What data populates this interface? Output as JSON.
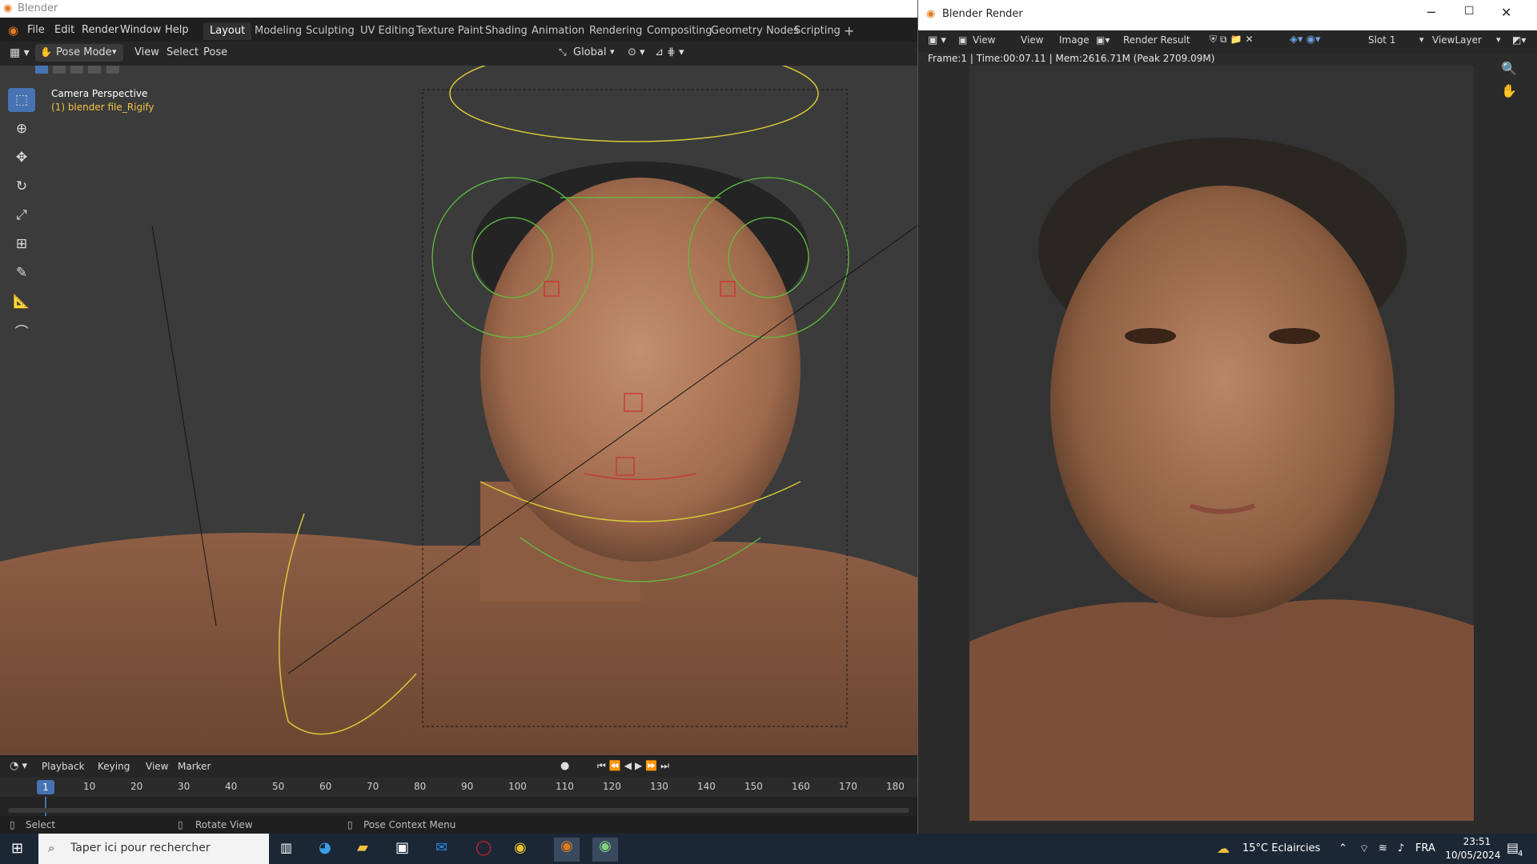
{
  "main_window": {
    "title": "Blender",
    "menu": [
      "File",
      "Edit",
      "Render",
      "Window",
      "Help"
    ],
    "workspaces": [
      "Layout",
      "Modeling",
      "Sculpting",
      "UV Editing",
      "Texture Paint",
      "Shading",
      "Animation",
      "Rendering",
      "Compositing",
      "Geometry Nodes",
      "Scripting"
    ],
    "active_workspace": "Layout"
  },
  "viewport_header": {
    "mode": "Pose Mode",
    "menu": [
      "View",
      "Select",
      "Pose"
    ],
    "orientation": "Global"
  },
  "viewport": {
    "overlay_title": "Camera Perspective",
    "overlay_object": "(1) blender file_Rigify"
  },
  "timeline": {
    "menu": [
      "Playback",
      "Keying",
      "View",
      "Marker"
    ],
    "current_frame": "1",
    "ticks": [
      "10",
      "20",
      "30",
      "40",
      "50",
      "60",
      "70",
      "80",
      "90",
      "100",
      "110",
      "120",
      "130",
      "140",
      "150",
      "160",
      "170",
      "180"
    ]
  },
  "statusbar": {
    "select": "Select",
    "rotate": "Rotate View",
    "context": "Pose Context Menu"
  },
  "render_window": {
    "title": "Blender Render",
    "menu": [
      "View",
      "View",
      "Image"
    ],
    "image_name": "Render Result",
    "slot": "Slot 1",
    "view_layer": "ViewLayer",
    "info": "Frame:1 | Time:00:07.11 | Mem:2616.71M (Peak 2709.09M)"
  },
  "taskbar": {
    "search_placeholder": "Taper ici pour rechercher",
    "weather": "15°C  Eclaircies",
    "lang": "FRA",
    "time": "23:51",
    "date": "10/05/2024",
    "notif_count": "4"
  },
  "colors": {
    "accent": "#4772b3",
    "rig_yellow": "#d8c83a",
    "rig_green": "#5fbf3e",
    "rig_red": "#c8342e"
  }
}
